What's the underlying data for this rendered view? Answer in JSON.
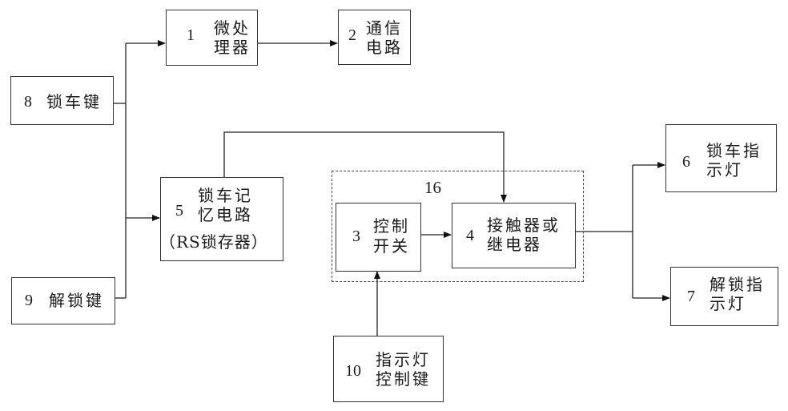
{
  "diagram": {
    "blocks": [
      {
        "id": "1",
        "number": "1",
        "label_line1": "微处",
        "label_line2": "理器"
      },
      {
        "id": "2",
        "number": "2",
        "label_line1": "通信",
        "label_line2": "电路"
      },
      {
        "id": "3",
        "number": "3",
        "label_line1": "控制",
        "label_line2": "开关"
      },
      {
        "id": "4",
        "number": "4",
        "label_line1": "接触器或",
        "label_line2": "继电器"
      },
      {
        "id": "5",
        "number": "5",
        "label_line1": "锁车记",
        "label_line2": "忆电路",
        "label_line3": "（RS锁存器）"
      },
      {
        "id": "6",
        "number": "6",
        "label_line1": "锁车指",
        "label_line2": "示灯"
      },
      {
        "id": "7",
        "number": "7",
        "label_line1": "解锁指",
        "label_line2": "示灯"
      },
      {
        "id": "8",
        "number": "8",
        "label_line1": "锁车键"
      },
      {
        "id": "9",
        "number": "9",
        "label_line1": "解锁键"
      },
      {
        "id": "10",
        "number": "10",
        "label_line1": "指示灯",
        "label_line2": "控制键"
      }
    ],
    "group": {
      "number": "16",
      "contains": [
        "3",
        "4"
      ]
    },
    "connections": [
      {
        "from": "8",
        "to": "1"
      },
      {
        "from": "8",
        "to": "5"
      },
      {
        "from": "9",
        "to": "1"
      },
      {
        "from": "9",
        "to": "5"
      },
      {
        "from": "1",
        "to": "2"
      },
      {
        "from": "5",
        "to": "4"
      },
      {
        "from": "3",
        "to": "4"
      },
      {
        "from": "10",
        "to": "3"
      },
      {
        "from": "4",
        "to": "6"
      },
      {
        "from": "4",
        "to": "7"
      }
    ]
  }
}
